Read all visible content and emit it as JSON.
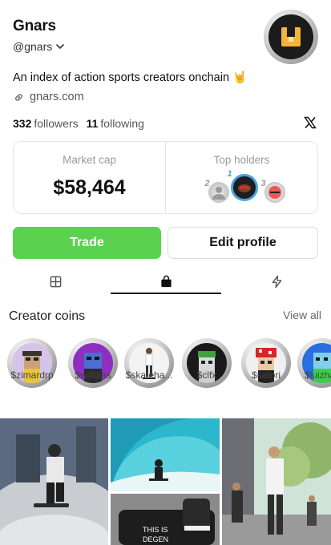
{
  "profile": {
    "name": "Gnars",
    "handle": "@gnars",
    "bio": "An index of action sports creators onchain",
    "bio_emoji": "🤘",
    "website": "gnars.com",
    "followers_count": "332",
    "followers_label": "followers",
    "following_count": "11",
    "following_label": "following"
  },
  "stats": {
    "market_cap_label": "Market cap",
    "market_cap_value": "$58,464",
    "top_holders_label": "Top holders",
    "holder_ranks": [
      "2",
      "1",
      "3"
    ]
  },
  "actions": {
    "trade_label": "Trade",
    "edit_label": "Edit profile"
  },
  "tabs": [
    {
      "icon": "grid-icon"
    },
    {
      "icon": "bag-icon",
      "active": true
    },
    {
      "icon": "lightning-icon"
    }
  ],
  "creator_coins": {
    "title": "Creator coins",
    "view_all": "View all",
    "items": [
      {
        "label": "$zimardrp"
      },
      {
        "label": "$willdias"
      },
      {
        "label": "$skateha..."
      },
      {
        "label": "$clfx"
      },
      {
        "label": "$satori"
      },
      {
        "label": "$luizhac"
      }
    ]
  },
  "colors": {
    "trade_green": "#5ad250",
    "text_primary": "#111111",
    "text_secondary": "#555555"
  }
}
